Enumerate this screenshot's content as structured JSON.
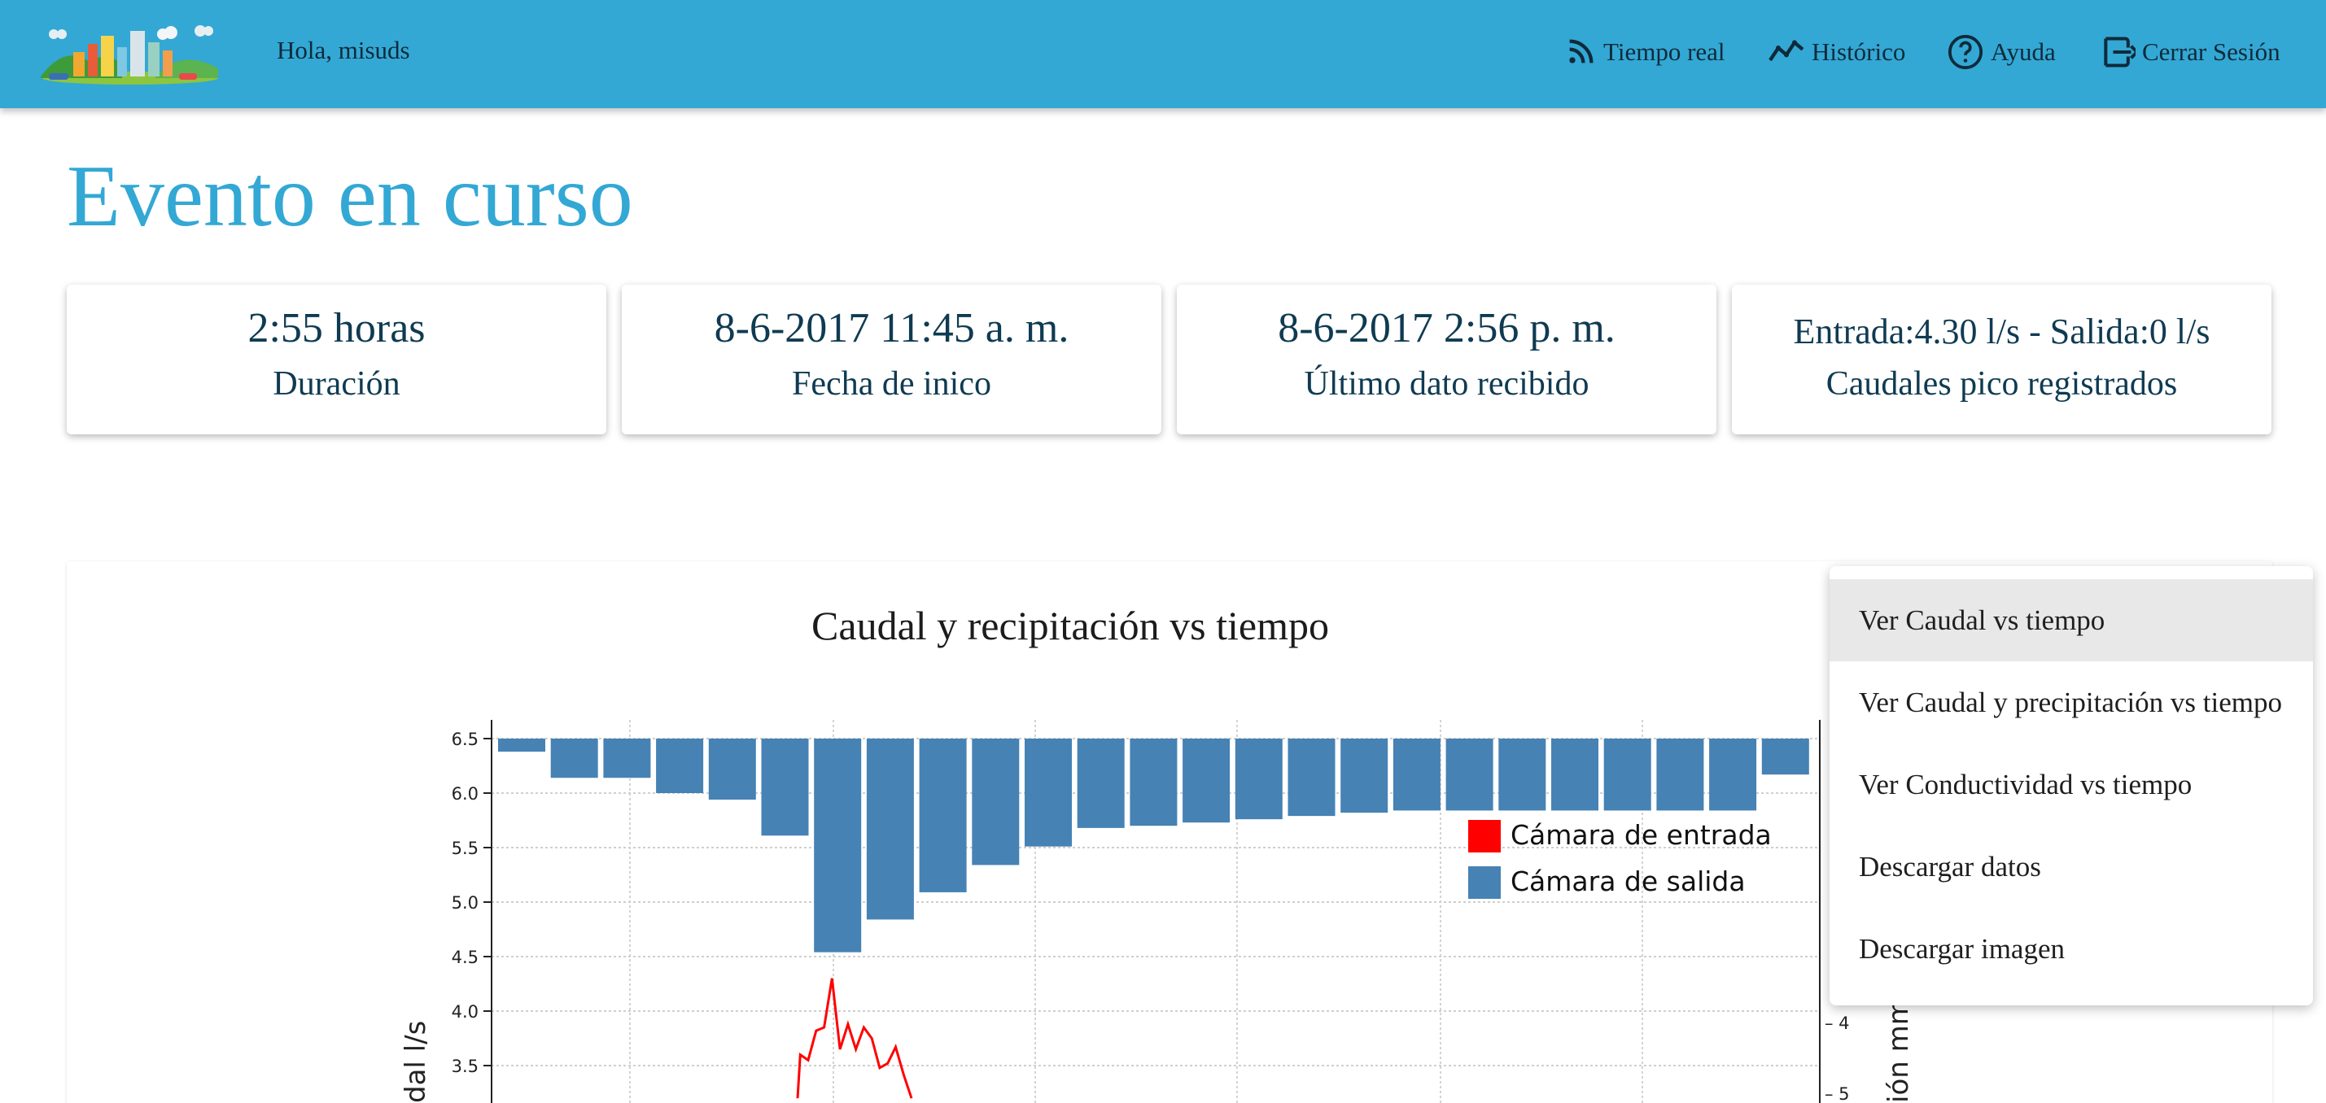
{
  "header": {
    "greeting": "Hola, misuds",
    "nav": [
      {
        "label": "Tiempo real",
        "icon": "rss-feed-icon"
      },
      {
        "label": "Histórico",
        "icon": "timeline-icon"
      },
      {
        "label": "Ayuda",
        "icon": "help-circle-icon"
      },
      {
        "label": "Cerrar Sesión",
        "icon": "logout-icon"
      }
    ],
    "logo_icon": "city-skyline-logo-icon",
    "colors": {
      "bar": "#33a8d4",
      "title": "#33a8d4"
    }
  },
  "page": {
    "title": "Evento en curso"
  },
  "cards": [
    {
      "value": "2:55 horas",
      "label": "Duración"
    },
    {
      "value": "8-6-2017 11:45 a. m.",
      "label": "Fecha de inico"
    },
    {
      "value": "8-6-2017 2:56 p. m.",
      "label": "Último dato recibido"
    },
    {
      "value": "Entrada:4.30 l/s - Salida:0 l/s",
      "label": "Caudales pico registrados"
    }
  ],
  "menu": {
    "items": [
      "Ver Caudal vs tiempo",
      "Ver Caudal y precipitación vs tiempo",
      "Ver Conductividad vs tiempo",
      "Descargar datos",
      "Descargar imagen"
    ],
    "active_index": 0
  },
  "chart_data": {
    "type": "bar",
    "title": "Caudal y recipitación vs tiempo",
    "ylabel_left_visible": "dal l/s",
    "ylabel_right_visible": "ión mm/",
    "ylim_left_visible": [
      3.2,
      6.6
    ],
    "yticks_left": [
      "6.5",
      "6.0",
      "5.5",
      "5.0",
      "4.5",
      "4.0",
      "3.5"
    ],
    "yticks_right": [
      "– 4",
      "– 5"
    ],
    "legend": [
      {
        "name": "Cámara de entrada",
        "color": "#ff0000"
      },
      {
        "name": "Cámara de salida",
        "color": "#4682b4"
      }
    ],
    "legend_position": "top-right",
    "grid": true,
    "series": [
      {
        "name": "Cámara de salida",
        "type": "bar",
        "color": "#4682b4",
        "bar_bottoms": [
          6.38,
          6.14,
          6.14,
          6.0,
          5.94,
          5.61,
          4.54,
          4.84,
          5.09,
          5.34,
          5.51,
          5.68,
          5.7,
          5.73,
          5.76,
          5.79,
          5.82,
          5.84,
          5.84,
          5.84,
          5.84,
          5.84,
          5.84,
          5.84,
          6.17
        ]
      },
      {
        "name": "Cámara de entrada",
        "type": "line",
        "color": "#ff0000",
        "points": [
          [
            6.72,
            3.2
          ],
          [
            6.74,
            3.6
          ],
          [
            6.8,
            3.55
          ],
          [
            6.86,
            3.82
          ],
          [
            6.92,
            3.85
          ],
          [
            6.98,
            4.3
          ],
          [
            7.04,
            3.65
          ],
          [
            7.1,
            3.88
          ],
          [
            7.16,
            3.65
          ],
          [
            7.22,
            3.85
          ],
          [
            7.28,
            3.75
          ],
          [
            7.34,
            3.48
          ],
          [
            7.4,
            3.52
          ],
          [
            7.46,
            3.67
          ],
          [
            7.52,
            3.42
          ],
          [
            7.58,
            3.2
          ]
        ]
      }
    ]
  }
}
